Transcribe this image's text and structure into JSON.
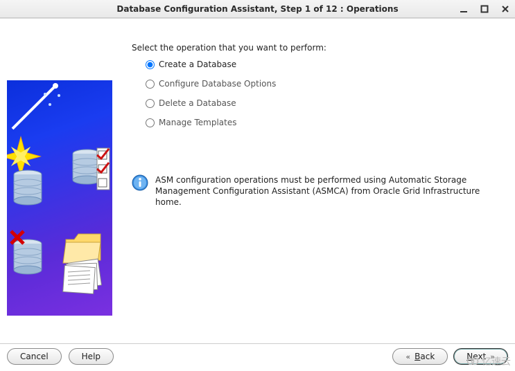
{
  "title": "Database Configuration Assistant, Step 1 of 12 : Operations",
  "prompt": "Select the operation that you want to perform:",
  "options": {
    "create": "Create a Database",
    "configure": "Configure Database Options",
    "delete": "Delete a Database",
    "manage": "Manage Templates"
  },
  "info": "ASM configuration operations must be performed using Automatic Storage Management Configuration Assistant (ASMCA) from Oracle Grid Infrastructure home.",
  "buttons": {
    "cancel": "Cancel",
    "help": "Help",
    "back": "Back",
    "next": "Next"
  },
  "watermark": "亿速云"
}
